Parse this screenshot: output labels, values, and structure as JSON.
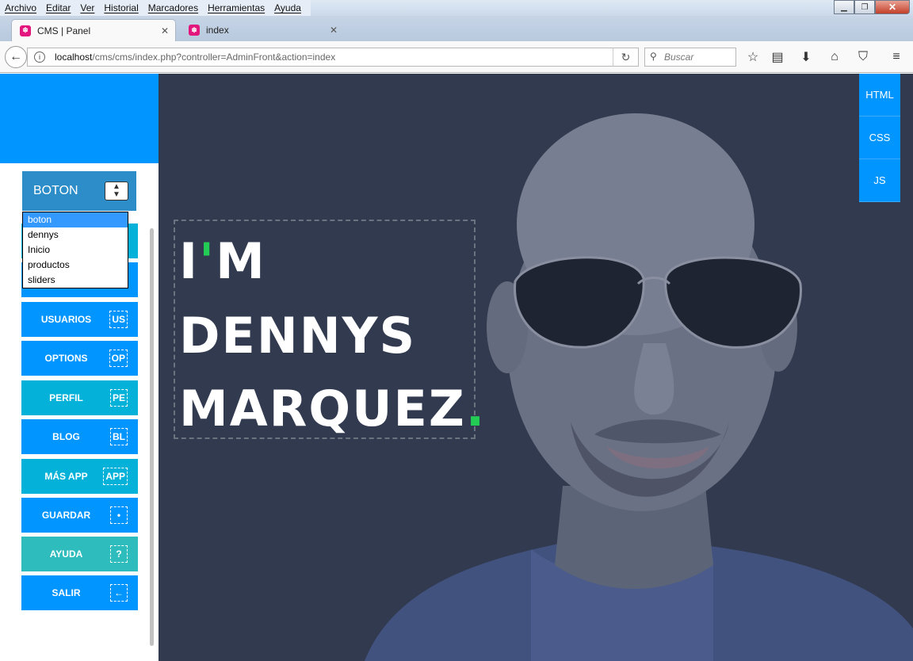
{
  "menubar": {
    "items": [
      "Archivo",
      "Editar",
      "Ver",
      "Historial",
      "Marcadores",
      "Herramientas",
      "Ayuda"
    ]
  },
  "tabs": [
    {
      "title": "CMS | Panel",
      "active": true
    },
    {
      "title": "index",
      "active": false
    }
  ],
  "navbar": {
    "url_host": "localhost",
    "url_path": "/cms/cms/index.php?controller=AdminFront&action=index",
    "search_placeholder": "Buscar"
  },
  "sidebar": {
    "select_value": "BOTON",
    "dropdown_options": [
      "boton",
      "dennys",
      "Inicio",
      "productos",
      "sliders"
    ],
    "buttons": [
      {
        "label": "USUARIOS",
        "badge": "US"
      },
      {
        "label": "OPTIONS",
        "badge": "OP"
      },
      {
        "label": "PERFIL",
        "badge": "PE"
      },
      {
        "label": "BLOG",
        "badge": "BL"
      },
      {
        "label": "MÁS APP",
        "badge": "APP"
      },
      {
        "label": "GUARDAR",
        "badge": "•"
      },
      {
        "label": "AYUDA",
        "badge": "?"
      },
      {
        "label": "SALIR",
        "badge": "←"
      }
    ]
  },
  "hero": {
    "line1_a": "I",
    "line1_apos": "'",
    "line1_b": "M",
    "line2": "DENNYS",
    "line3": "MARQUEZ",
    "line3_dot": "."
  },
  "side_tools": [
    "HTML",
    "CSS",
    "JS"
  ],
  "colors": {
    "accent_blue": "#0095ff",
    "accent_cyan": "#04b1d8",
    "accent_teal": "#2ebcbc",
    "hero_bg": "#313a4f",
    "highlight_green": "#22cc55"
  }
}
